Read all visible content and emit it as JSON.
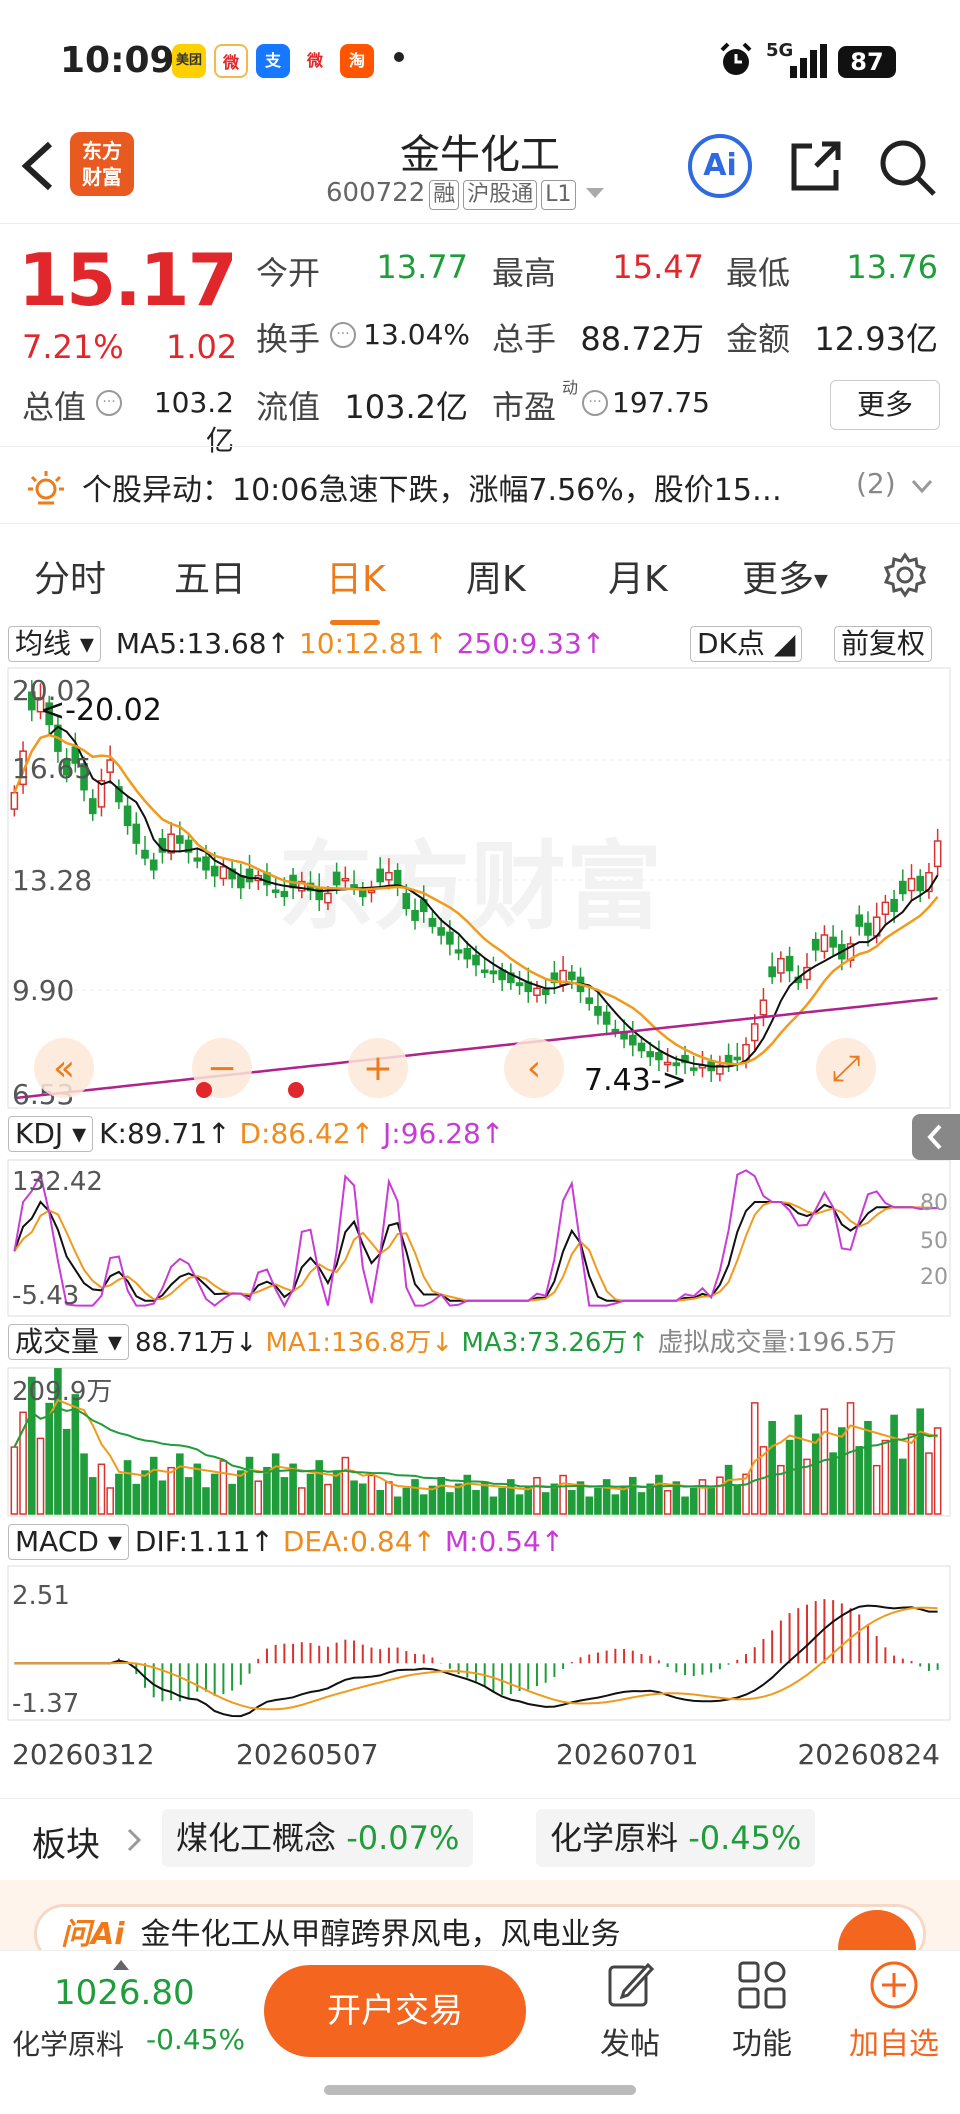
{
  "status_bar": {
    "time": "10:09",
    "apps": [
      "美团",
      "微",
      "支",
      "微",
      "淘"
    ],
    "network": "5G",
    "battery": "87"
  },
  "header": {
    "back": "<",
    "logo": "东方\n财富",
    "title": "金牛化工",
    "code": "600722",
    "tags": [
      "融",
      "沪股通",
      "L1"
    ],
    "ai": "Ai"
  },
  "quote": {
    "price": "15.17",
    "change_pct": "7.21%",
    "change": "1.02",
    "fields": [
      {
        "label": "今开",
        "value": "13.77",
        "color": "green"
      },
      {
        "label": "最高",
        "value": "15.47",
        "color": "red"
      },
      {
        "label": "最低",
        "value": "13.76",
        "color": "green"
      },
      {
        "label": "换手",
        "value": "13.04%",
        "color": "black"
      },
      {
        "label": "总手",
        "value": "88.72万",
        "color": "black"
      },
      {
        "label": "金额",
        "value": "12.93亿",
        "color": "black"
      },
      {
        "label": "总值",
        "value": "103.2亿",
        "color": "black"
      },
      {
        "label": "流值",
        "value": "103.2亿",
        "color": "black"
      },
      {
        "label": "市盈",
        "value": "197.75",
        "color": "black"
      }
    ],
    "more": "更多"
  },
  "alert": {
    "text": "个股异动：10:06急速下跌，涨幅7.56%，股价15…",
    "count": "(2)"
  },
  "tabs": [
    "分时",
    "五日",
    "日K",
    "周K",
    "月K",
    "更多"
  ],
  "active_tab": "日K",
  "ma_bar": {
    "dropdown": "均线",
    "ma5": "MA5:13.68↑",
    "ma10": "10:12.81↑",
    "ma250": "250:9.33↑",
    "dk": "DK点",
    "adjust": "前复权"
  },
  "kdj_bar": {
    "dropdown": "KDJ",
    "k": "K:89.71↑",
    "d": "D:86.42↑",
    "j": "J:96.28↑"
  },
  "vol_bar": {
    "dropdown": "成交量",
    "vol": "88.71万↓",
    "ma1": "MA1:136.8万↓",
    "ma3": "MA3:73.26万↑",
    "virtual": "虚拟成交量:196.5万"
  },
  "macd_bar": {
    "dropdown": "MACD",
    "dif": "DIF:1.11↑",
    "dea": "DEA:0.84↑",
    "m": "M:0.54↑"
  },
  "chart_data": {
    "type": "candlestick",
    "price_axis": [
      "20.02",
      "16.65",
      "13.28",
      "9.90",
      "6.53"
    ],
    "annotations": [
      "<-20.02",
      "7.43->"
    ],
    "kdj_axis": [
      "132.42",
      "-5.43"
    ],
    "kdj_levels": [
      "80",
      "50",
      "20"
    ],
    "vol_axis": [
      "209.9万"
    ],
    "macd_axis": [
      "2.51",
      "-1.37"
    ],
    "dates": [
      "20260312",
      "20260507",
      "20260701",
      "20260824"
    ],
    "watermark": "东方财富",
    "close_series": [
      16.8,
      18.2,
      19.6,
      20.0,
      19.1,
      18.2,
      17.4,
      17.8,
      16.9,
      16.1,
      17.2,
      17.9,
      16.5,
      15.7,
      15.1,
      14.6,
      14.2,
      14.8,
      15.4,
      15.1,
      14.8,
      14.5,
      14.2,
      14.0,
      14.3,
      13.9,
      13.6,
      13.8,
      14.0,
      13.7,
      13.5,
      13.3,
      13.6,
      13.8,
      13.5,
      13.2,
      13.4,
      13.7,
      13.9,
      13.6,
      13.3,
      13.5,
      13.8,
      14.1,
      13.7,
      12.9,
      12.5,
      12.8,
      12.3,
      12.0,
      11.7,
      11.4,
      11.2,
      11.0,
      10.8,
      10.7,
      10.5,
      10.4,
      10.3,
      10.1,
      10.2,
      10.0,
      10.4,
      10.8,
      10.5,
      10.1,
      9.7,
      9.3,
      9.0,
      8.8,
      8.5,
      8.3,
      8.1,
      7.9,
      7.8,
      7.7,
      7.6,
      7.7,
      7.5,
      7.6,
      7.43,
      7.6,
      7.7,
      7.8,
      8.3,
      9.0,
      9.8,
      10.6,
      11.2,
      10.8,
      10.4,
      10.9,
      11.5,
      12.0,
      11.6,
      11.2,
      11.7,
      12.3,
      12.0,
      12.6,
      13.1,
      12.8,
      13.4,
      13.9,
      13.5,
      14.1,
      15.17
    ]
  },
  "sector": {
    "label": "板块",
    "items": [
      {
        "name": "煤化工概念",
        "pct": "-0.07%"
      },
      {
        "name": "化学原料",
        "pct": "-0.45%"
      }
    ]
  },
  "ai_banner": {
    "text": "金牛化工从甲醇跨界风电，风电业务"
  },
  "bottom": {
    "index_value": "1026.80",
    "index_name": "化学原料",
    "index_pct": "-0.45%",
    "trade": "开户交易",
    "nav": [
      "发帖",
      "功能",
      "加自选"
    ]
  }
}
